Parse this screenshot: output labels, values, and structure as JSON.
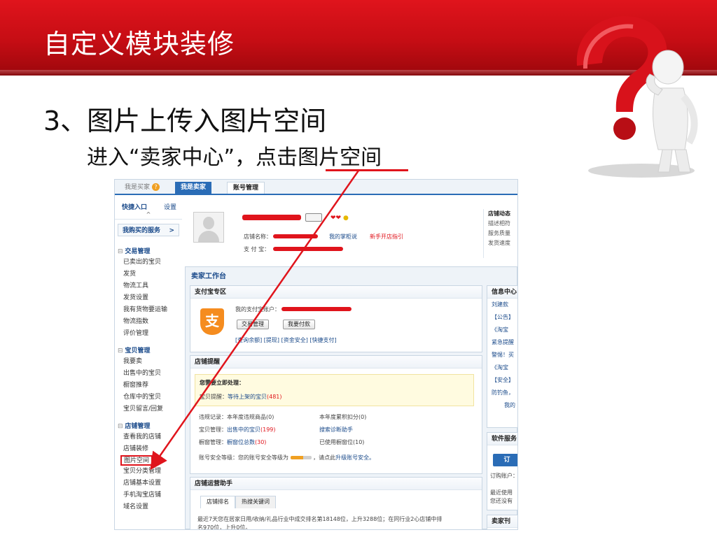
{
  "slide": {
    "title": "自定义模块装修",
    "bullet": "3、图片上传入图片空间",
    "subtext": "进入“卖家中心”，点击图片空间"
  },
  "colors": {
    "accent": "#e0141c",
    "link": "#1a4a8a",
    "nav_blue": "#2a6cb6"
  },
  "screenshot": {
    "topnav": {
      "buyer": "我是买家",
      "seller": "我是卖家",
      "account": "账号管理",
      "help_icon": "question-icon"
    },
    "sidebar": {
      "quick_entry": "快捷入口",
      "settings": "设置",
      "caret": "^",
      "services": "我购买的服务",
      "services_arrow": ">",
      "sections": [
        {
          "title": "交易管理",
          "items": [
            "已卖出的宝贝",
            "发货",
            "物流工具",
            "发货设置",
            "我有货物要运输",
            "物流指数",
            "评价管理"
          ]
        },
        {
          "title": "宝贝管理",
          "items": [
            "我要卖",
            "出售中的宝贝",
            "橱窗推荐",
            "仓库中的宝贝",
            "宝贝留言/回复"
          ]
        },
        {
          "title": "店铺管理",
          "items": [
            "查看我的店铺",
            "店铺装修",
            "图片空间",
            "宝贝分类管理",
            "店铺基本设置",
            "手机淘宝店铺",
            "域名设置"
          ]
        }
      ]
    },
    "profile": {
      "shop_name_label": "店铺名称：",
      "alipay_label": "支 付 宝：",
      "my_counter": "我的掌柜说",
      "newbie_guide": "新手开店指引",
      "right_title": "店铺动态",
      "right_lines": [
        "描述相符",
        "服务质量",
        "发货速度"
      ]
    },
    "workbench": {
      "title": "卖家工作台",
      "alipay_panel": {
        "title": "支付宝专区",
        "account_label": "我的支付宝账户：",
        "btn_manage": "交易管理",
        "btn_pay": "我要付款",
        "links": "[查询余额]  [提现]  [资金安全]  [快捷支付]"
      },
      "reminder_panel": {
        "title": "店铺提醒",
        "urgent": "您需要立即处理：",
        "item_reminder_label": "宝贝提醒：",
        "item_reminder_link": "等待上架的宝贝",
        "item_reminder_count": "(481)",
        "violation_label": "违规记录：",
        "violation_text": "本年度违规商品",
        "violation_count": "(0)",
        "annual_score_text": "本年度累积扣分",
        "annual_score_count": "(0)",
        "goods_label": "宝贝管理：",
        "goods_link": "出售中的宝贝",
        "goods_count": "(199)",
        "search_helper": "搜索诊断助手",
        "window_label": "橱窗管理：",
        "window_link": "橱窗位总数",
        "window_count": "(30)",
        "window_used_text": "已使用橱窗位",
        "window_used_count": "(10)",
        "security_label": "账号安全等级：",
        "security_text": "您的账号安全等级为",
        "security_tail": "，请点此",
        "security_link": "升级账号安全。"
      },
      "ops_panel": {
        "title": "店铺运营助手",
        "tab_rank": "店铺排名",
        "tab_keywords": "热搜关键词",
        "line1": "最近7天您在居家日用/收纳/礼品行业中成交排名第18148位，上升3288位；在同行业2心店铺中排",
        "line2": "名970位，上升0位。"
      },
      "info_panel": {
        "title": "信息中心",
        "items": [
          "刘建款",
          "【公告】",
          "《淘宝",
          "紧急提醒",
          "警惕！买",
          "《淘宝",
          "【安全】",
          "防钓鱼，",
          "我的"
        ]
      },
      "software_panel": {
        "title": "软件服务",
        "order": "订",
        "line1": "订购账户：",
        "line2": "最近使用",
        "line3": "您还没有"
      },
      "seller_panel": {
        "title": "卖家刊"
      }
    }
  }
}
